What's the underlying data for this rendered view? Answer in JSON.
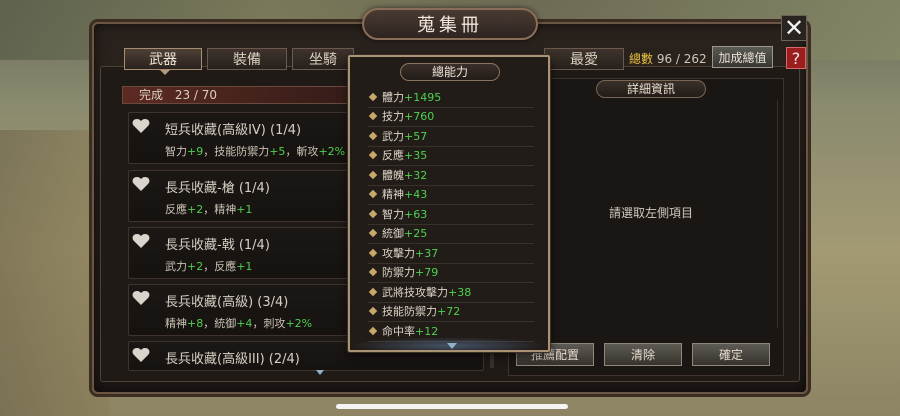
{
  "window": {
    "title": "蒐集冊",
    "close_label": "✕",
    "help_label": "?"
  },
  "tabs": [
    {
      "label": "武器",
      "active": true
    },
    {
      "label": "裝備"
    },
    {
      "label": "坐騎"
    },
    {
      "label": "最愛"
    }
  ],
  "header": {
    "total_label": "總數",
    "total_value": "96 / 262",
    "add_total_button": "加成總值"
  },
  "progress": {
    "label": "完成",
    "value": "23 / 70"
  },
  "collection": [
    {
      "title": "短兵收藏(高級IV) (1/4)",
      "stats": [
        {
          "name": "智力",
          "val": "+9"
        },
        {
          "name": "技能防禦力",
          "val": "+5"
        },
        {
          "name": "斬攻",
          "val": "+2%"
        }
      ]
    },
    {
      "title": "長兵收藏-槍 (1/4)",
      "stats": [
        {
          "name": "反應",
          "val": "+2"
        },
        {
          "name": "精神",
          "val": "+1"
        }
      ]
    },
    {
      "title": "長兵收藏-戟 (1/4)",
      "stats": [
        {
          "name": "武力",
          "val": "+2"
        },
        {
          "name": "反應",
          "val": "+1"
        }
      ]
    },
    {
      "title": "長兵收藏(高級) (3/4)",
      "stats": [
        {
          "name": "精神",
          "val": "+8"
        },
        {
          "name": "統御",
          "val": "+4"
        },
        {
          "name": "刺攻",
          "val": "+2%"
        }
      ]
    },
    {
      "title": "長兵收藏(高級III) (2/4)",
      "stats": []
    }
  ],
  "total_power": {
    "title": "總能力",
    "stats": [
      {
        "name": "體力",
        "val": "+1495"
      },
      {
        "name": "技力",
        "val": "+760"
      },
      {
        "name": "武力",
        "val": "+57"
      },
      {
        "name": "反應",
        "val": "+35"
      },
      {
        "name": "體魄",
        "val": "+32"
      },
      {
        "name": "精神",
        "val": "+43"
      },
      {
        "name": "智力",
        "val": "+63"
      },
      {
        "name": "統御",
        "val": "+25"
      },
      {
        "name": "攻擊力",
        "val": "+37"
      },
      {
        "name": "防禦力",
        "val": "+79"
      },
      {
        "name": "武將技攻擊力",
        "val": "+38"
      },
      {
        "name": "技能防禦力",
        "val": "+72"
      },
      {
        "name": "命中率",
        "val": "+12"
      }
    ]
  },
  "detail": {
    "title": "詳細資訊",
    "empty_text": "請選取左側項目"
  },
  "buttons": {
    "recommend": "推薦配置",
    "clear": "清除",
    "confirm": "確定"
  },
  "colors": {
    "accent_green": "#4fd04f",
    "accent_gold": "#e6c23f",
    "help_red": "#9b1e1e"
  }
}
